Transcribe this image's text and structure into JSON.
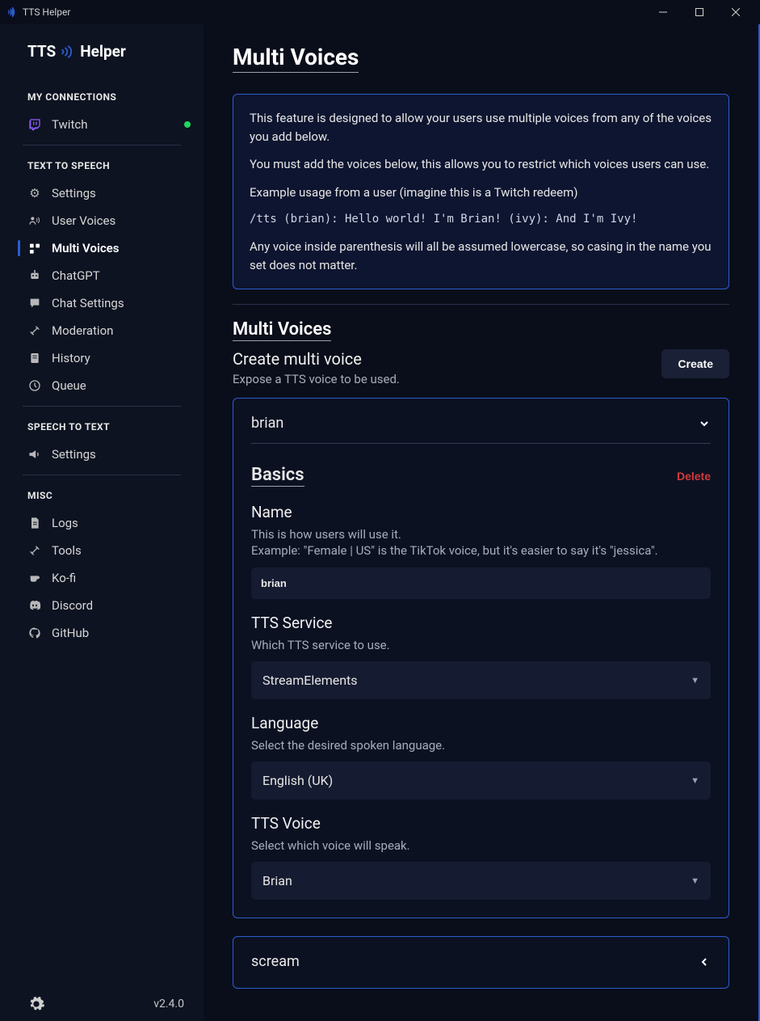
{
  "window": {
    "title": "TTS Helper"
  },
  "app": {
    "logo_tts": "TTS",
    "logo_helper": "Helper"
  },
  "sidebar": {
    "bottom": {
      "version": "v2.4.0"
    },
    "sections": {
      "connections": {
        "label": "MY CONNECTIONS",
        "items": [
          {
            "label": "Twitch"
          }
        ]
      },
      "tts": {
        "label": "TEXT TO SPEECH",
        "items": [
          {
            "label": "Settings"
          },
          {
            "label": "User Voices"
          },
          {
            "label": "Multi Voices"
          },
          {
            "label": "ChatGPT"
          },
          {
            "label": "Chat Settings"
          },
          {
            "label": "Moderation"
          },
          {
            "label": "History"
          },
          {
            "label": "Queue"
          }
        ]
      },
      "stt": {
        "label": "SPEECH TO TEXT",
        "items": [
          {
            "label": "Settings"
          }
        ]
      },
      "misc": {
        "label": "MISC",
        "items": [
          {
            "label": "Logs"
          },
          {
            "label": "Tools"
          },
          {
            "label": "Ko-fi"
          },
          {
            "label": "Discord"
          },
          {
            "label": "GitHub"
          }
        ]
      }
    }
  },
  "page": {
    "title": "Multi Voices",
    "info": {
      "p1": "This feature is designed to allow your users use multiple voices from any of the voices you add below.",
      "p2": "You must add the voices below, this allows you to restrict which voices users can use.",
      "p3": "Example usage from a user (imagine this is a Twitch redeem)",
      "code": "/tts (brian): Hello world! I'm Brian! (ivy): And I'm Ivy!",
      "p4": "Any voice inside parenthesis will all be assumed lowercase, so casing in the name you set does not matter."
    },
    "section2": {
      "title": "Multi Voices",
      "subtitle": "Create multi voice",
      "desc": "Expose a TTS voice to be used.",
      "create_btn": "Create"
    },
    "voice": {
      "header": "brian",
      "basics_title": "Basics",
      "delete_btn": "Delete",
      "name": {
        "label": "Name",
        "desc_line1": "This is how users will use it.",
        "desc_line2": "Example: \"Female | US\" is the TikTok voice, but it's easier to say it's \"jessica\".",
        "value": "brian"
      },
      "service": {
        "label": "TTS Service",
        "desc": "Which TTS service to use.",
        "value": "StreamElements"
      },
      "language": {
        "label": "Language",
        "desc": "Select the desired spoken language.",
        "value": "English (UK)"
      },
      "ttsvoice": {
        "label": "TTS Voice",
        "desc": "Select which voice will speak.",
        "value": "Brian"
      }
    },
    "voice2": {
      "header": "scream"
    }
  }
}
